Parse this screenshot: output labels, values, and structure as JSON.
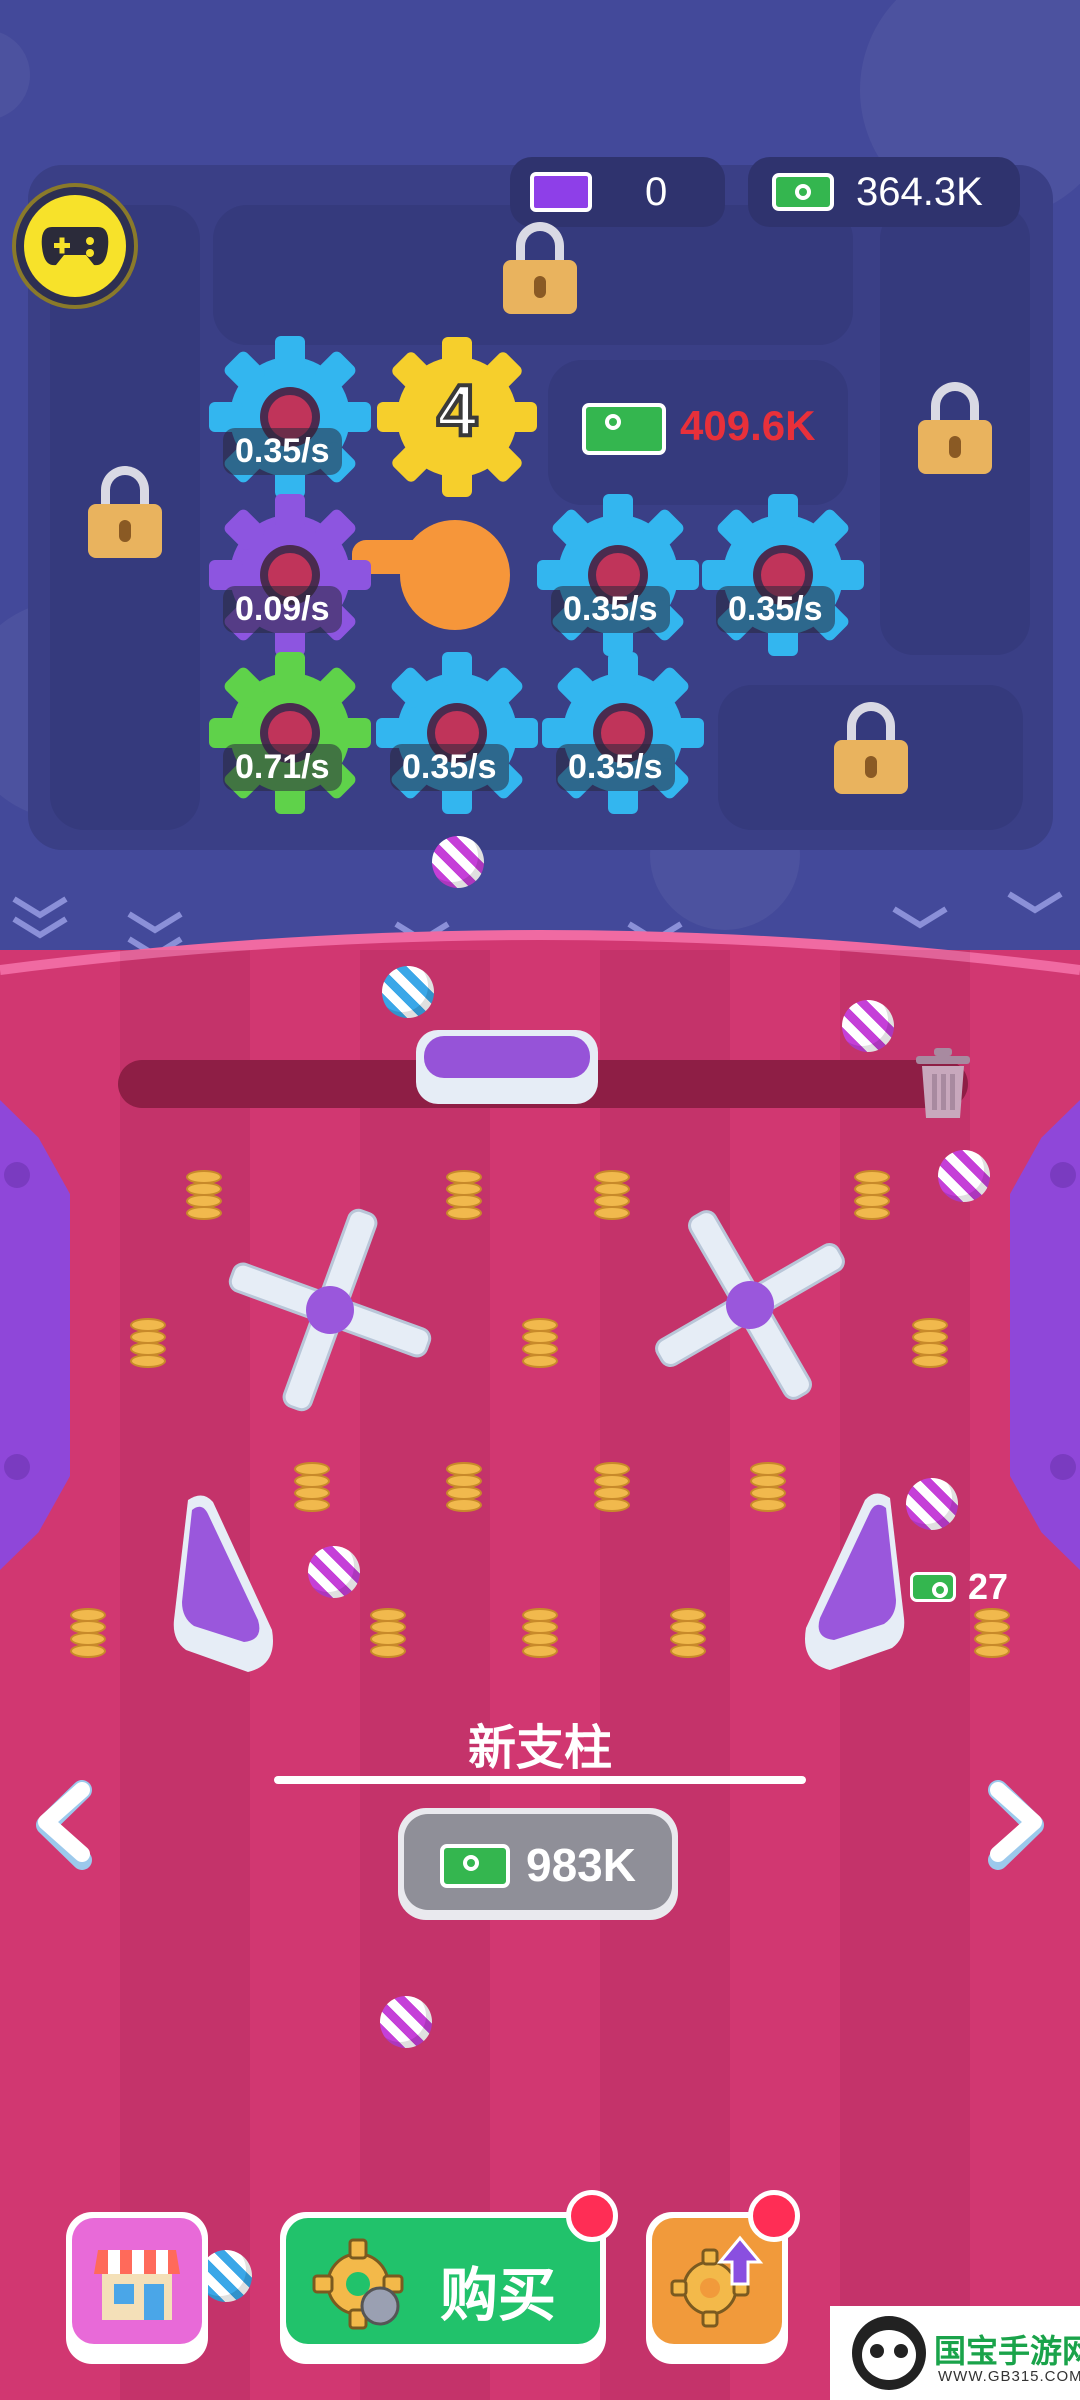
{
  "top_bar": {
    "tickets_value": "0",
    "cash_value": "364.3K"
  },
  "board": {
    "merge_price": "409.6K",
    "merge_number": "4",
    "gears": [
      {
        "rate": "0.35/s",
        "color": "#33b6ef"
      },
      {
        "rate": "0.09/s",
        "color": "#8d55e0"
      },
      {
        "rate": "0.35/s",
        "color": "#33b6ef"
      },
      {
        "rate": "0.35/s",
        "color": "#33b6ef"
      },
      {
        "rate": "0.71/s",
        "color": "#5fd24a"
      },
      {
        "rate": "0.35/s",
        "color": "#33b6ef"
      },
      {
        "rate": "0.35/s",
        "color": "#33b6ef"
      }
    ]
  },
  "field": {
    "side_reward": "27",
    "upgrade_title": "新支柱",
    "upgrade_price": "983K"
  },
  "bottom": {
    "buy_label": "购买"
  },
  "watermark": {
    "name": "国宝手游网",
    "url": "WWW.GB315.COM"
  },
  "colors": {
    "board_bg": "#43499a",
    "field_bg": "#d13771",
    "buy_green": "#21c26b",
    "shop_pink": "#e86ad8",
    "upgrade_orange": "#f19a3b",
    "price_red": "#e8303a"
  },
  "icons": [
    "gamepad-icon",
    "ticket-icon",
    "cash-icon",
    "lock-icon",
    "trash-icon",
    "gear-icon",
    "shop-icon",
    "upgrade-arrow-icon",
    "chevron-left-icon",
    "chevron-right-icon"
  ]
}
